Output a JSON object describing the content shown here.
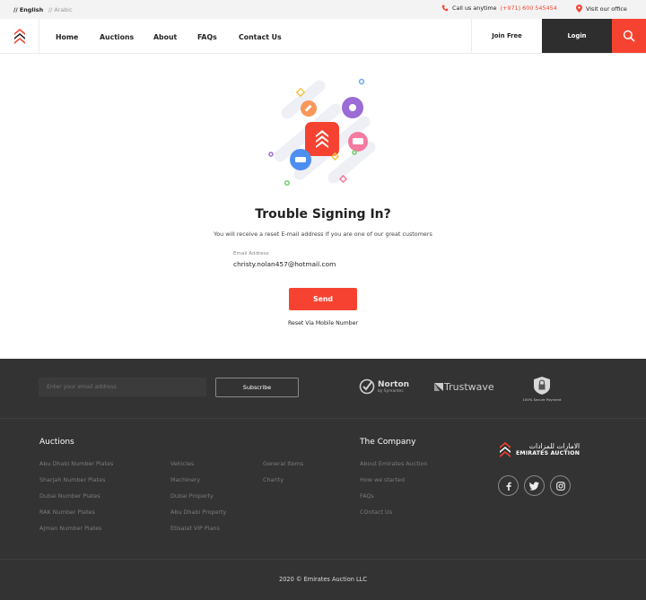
{
  "topbar": {
    "lang_english": "// English",
    "lang_arabic": "// Arabic",
    "call_label": "Call us anytime",
    "phone": "(+971) 600 545454",
    "visit_label": "Visit our office"
  },
  "nav": {
    "items": [
      "Home",
      "Auctions",
      "About",
      "FAQs",
      "Contact Us"
    ],
    "join": "Join Free",
    "login": "Login"
  },
  "main": {
    "title": "Trouble Signing In?",
    "subtitle": "You will receive a reset E-mail address if you are one of our great customers",
    "email_label": "Email Address",
    "email_value": "christy.nolan457@hotmail.com",
    "send": "Send",
    "reset_mobile": "Reset Via Mobile Number"
  },
  "footer": {
    "email_placeholder": "Enter your email address",
    "subscribe": "Subscribe",
    "norton_name": "Norton",
    "norton_sub": "by Symantec",
    "trustwave": "Trustwave",
    "secure_payment": "100% Secure Payment",
    "auctions_title": "Auctions",
    "auctions_col1": [
      "Abu Dhabi Number Plates",
      "Sharjah Number Plates",
      "Dubai Number Plates",
      "RAK Number Plates",
      "Ajman Number Plates"
    ],
    "auctions_col2": [
      "Vehicles",
      "Machinery",
      "Dubai Property",
      "Abu Dhabi Property",
      "Etisalat VIP Plans"
    ],
    "auctions_col3": [
      "General Items",
      "Charity"
    ],
    "company_title": "The Company",
    "company_links": [
      "About Emirates Auction",
      "How we started",
      "FAQs",
      "COntact Us"
    ],
    "brand_arabic": "الامارات للمزادات",
    "brand_name": "EMIRATES AUCTION",
    "copyright": "2020 © Emirates Auction LLC"
  },
  "colors": {
    "accent": "#f64331",
    "dark": "#333333",
    "login_bg": "#2e2e2e"
  },
  "icons": [
    "phone-icon",
    "location-pin-icon",
    "search-icon",
    "facebook-icon",
    "twitter-icon",
    "instagram-icon",
    "lock-icon"
  ]
}
